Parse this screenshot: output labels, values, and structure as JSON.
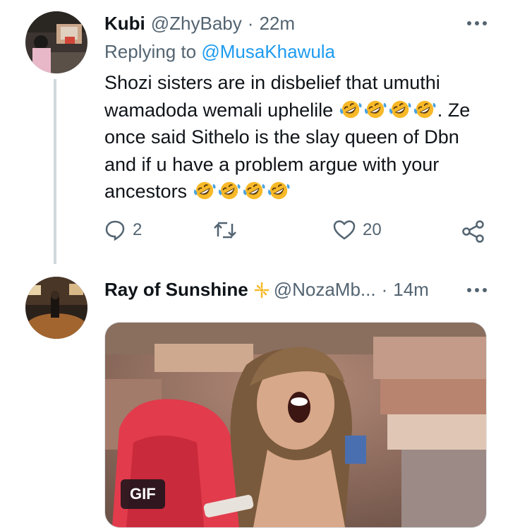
{
  "tweet1": {
    "display_name": "Kubi",
    "handle": "@ZhyBaby",
    "separator": "·",
    "time": "22m",
    "replying_prefix": "Replying to",
    "replying_handle": "@MusaKhawula",
    "text_line1": "Shozi sisters are in disbelief that umuthi",
    "text_line2a": "wamadoda wemali uphelile",
    "text_line2b": ". Ze",
    "text_line3": "once said Sithelo is the slay queen of Dbn",
    "text_line4": "and if u have a problem argue with your",
    "text_line5": "ancestors",
    "emoji_name": "rolling-on-floor-laughing",
    "reply_count": "2",
    "retweet_count": "",
    "like_count": "20"
  },
  "tweet2": {
    "display_name": "Ray of Sunshine",
    "name_emoji": "sparkle-sun-icon",
    "handle": "@NozaMb...",
    "separator": "·",
    "time": "14m",
    "media_badge": "GIF"
  },
  "colors": {
    "text": "#0f1419",
    "secondary": "#536471",
    "link": "#1d9bf0",
    "thread_line": "#cfd9de",
    "emoji_yellow": "#f7b928",
    "tear_blue": "#4aa3df"
  }
}
